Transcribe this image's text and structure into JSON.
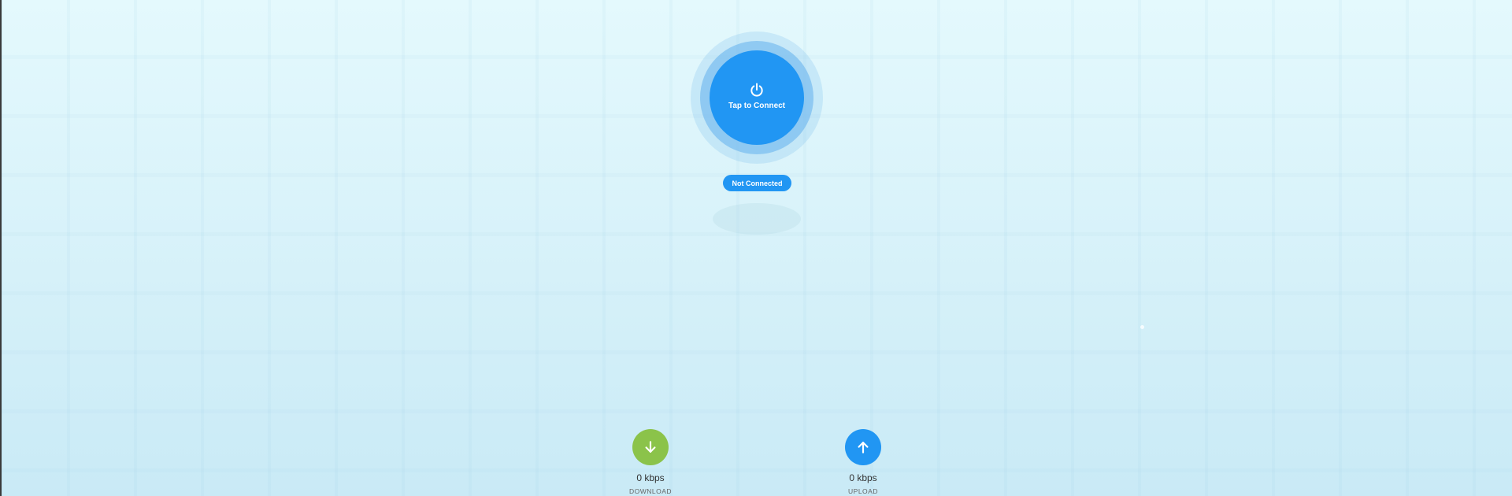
{
  "connect_button": {
    "label": "Tap to Connect",
    "icon": "power-icon"
  },
  "status": {
    "text": "Not Connected"
  },
  "stats": {
    "download": {
      "value": "0 kbps",
      "label": "DOWNLOAD",
      "icon": "arrow-down-icon",
      "color": "#8bc34a"
    },
    "upload": {
      "value": "0 kbps",
      "label": "UPLOAD",
      "icon": "arrow-up-icon",
      "color": "#2196f3"
    }
  },
  "colors": {
    "accent": "#2196f3",
    "ring": "#78bcf0",
    "download": "#8bc34a",
    "background": "#d8f2fa"
  }
}
